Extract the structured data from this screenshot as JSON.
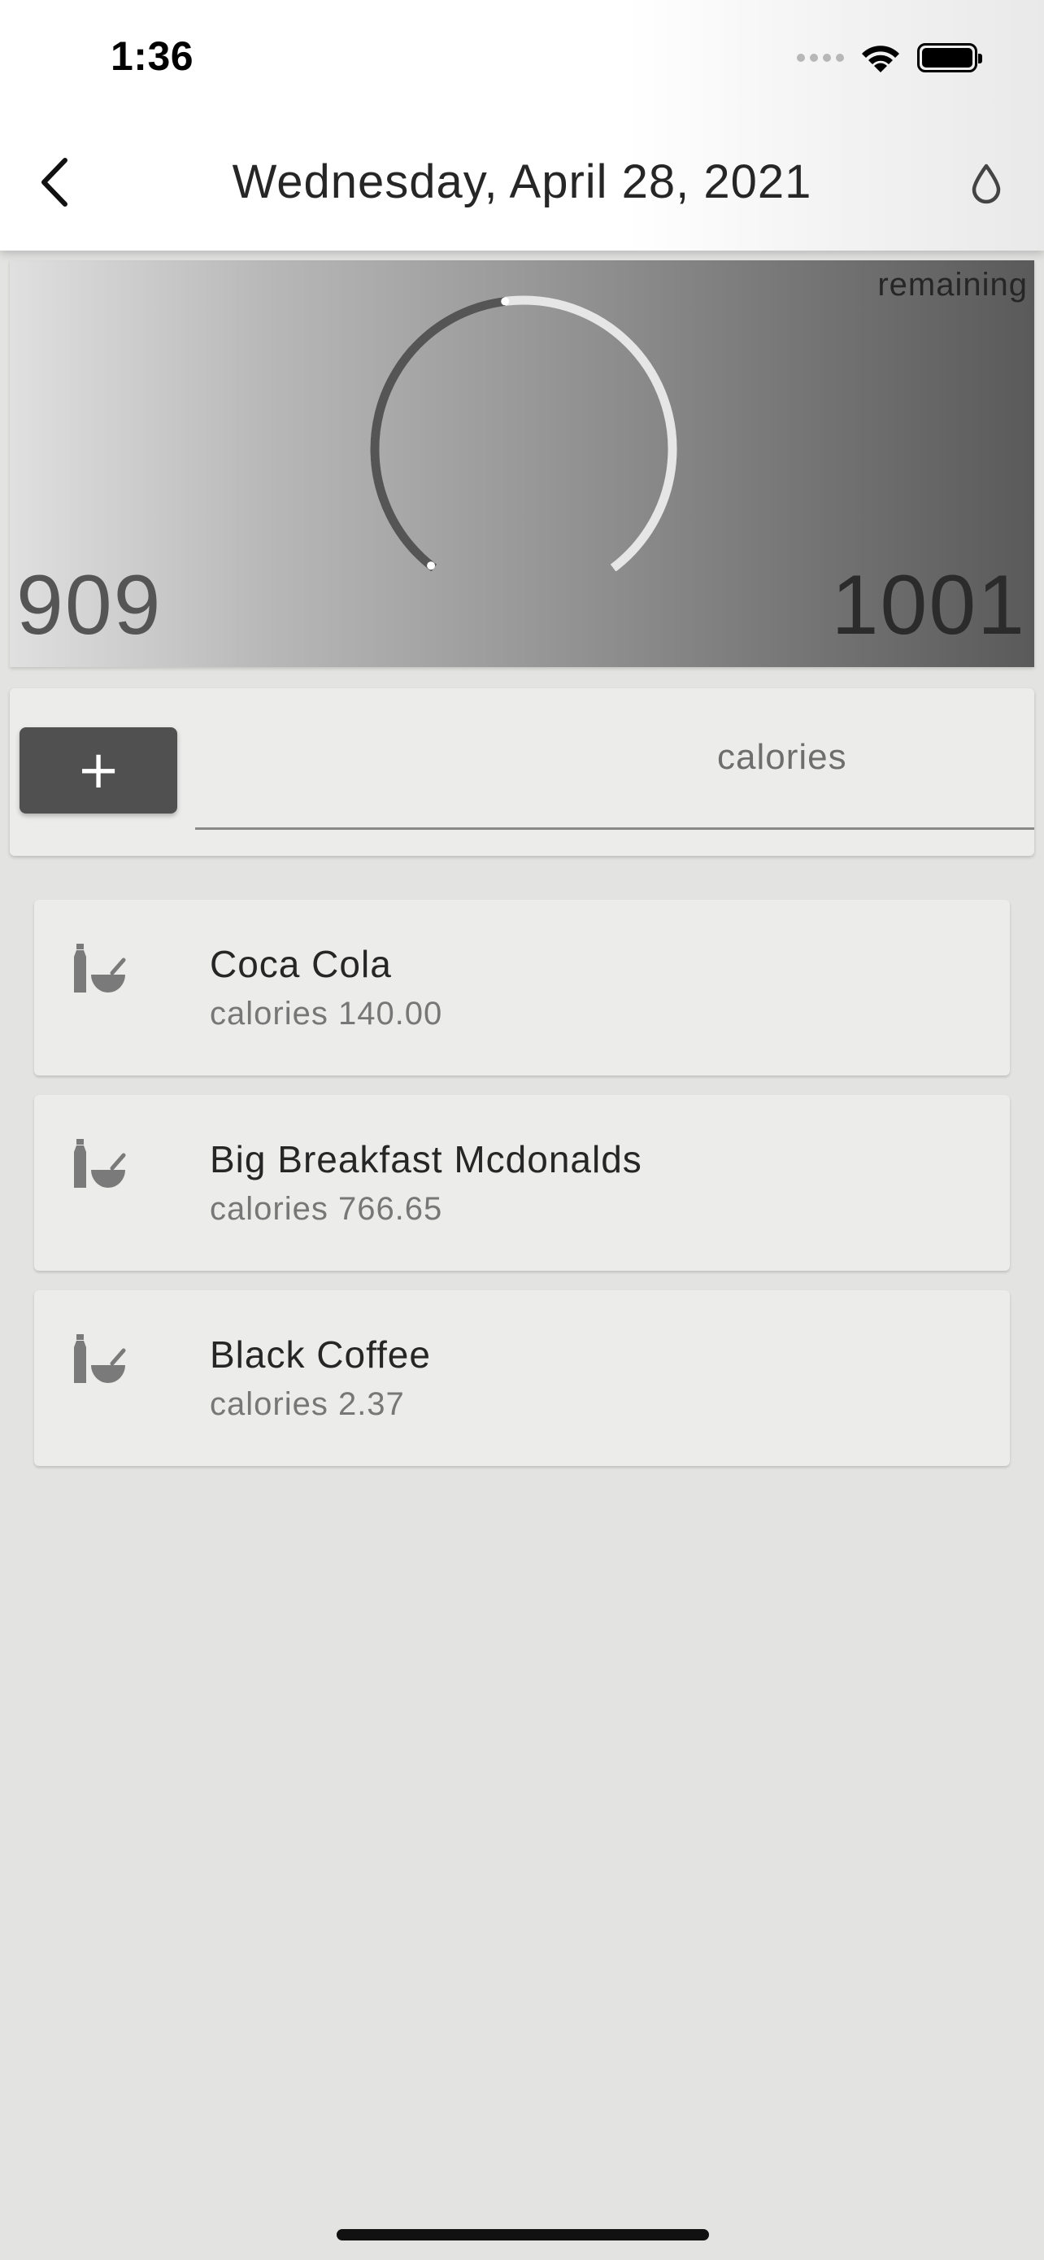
{
  "status_bar": {
    "time": "1:36"
  },
  "app_bar": {
    "title": "Wednesday, April 28, 2021",
    "back_icon": "chevron-left-icon",
    "action_icon": "water-drop-icon"
  },
  "summary": {
    "remaining_label": "remaining",
    "left_value": "909",
    "right_value": "1001",
    "gauge_fraction_consumed": 0.475
  },
  "entry_form": {
    "add_label": "+",
    "name_value": "",
    "calories_label": "calories",
    "calories_value": ""
  },
  "food_items": [
    {
      "name": "Coca Cola",
      "calories": "calories 140.00",
      "icon": "food-drink-icon"
    },
    {
      "name": "Big Breakfast Mcdonalds",
      "calories": "calories 766.65",
      "icon": "food-drink-icon"
    },
    {
      "name": "Black Coffee",
      "calories": "calories 2.37",
      "icon": "food-drink-icon"
    }
  ],
  "colors": {
    "accent_dark": "#505050",
    "background": "#e3e3e2",
    "card": "#ececeb"
  }
}
